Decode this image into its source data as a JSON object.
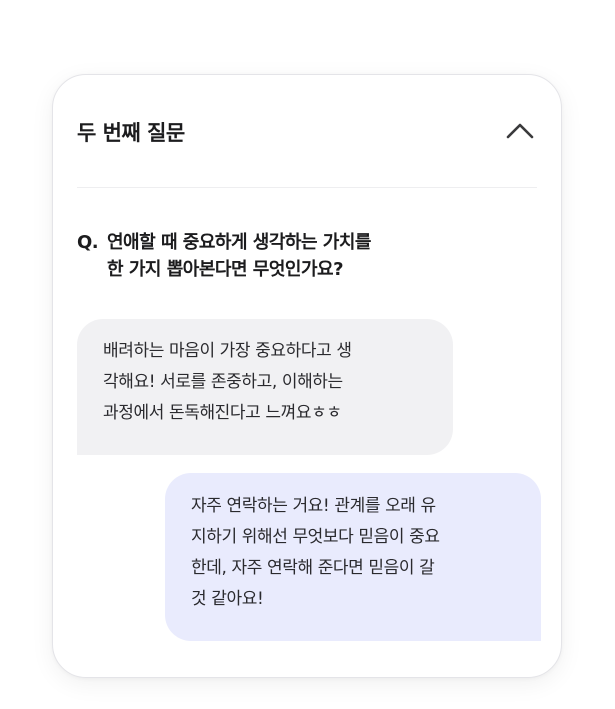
{
  "card": {
    "title": "두 번째 질문",
    "toggle_icon": "chevron-up-icon"
  },
  "question": {
    "prefix": "Q.",
    "line1": "연애할 때 중요하게 생각하는 가치를",
    "line2": "한 가지 뽑아본다면 무엇인가요?"
  },
  "answers": [
    {
      "side": "left",
      "lines": [
        "배려하는 마음이 가장 중요하다고 생",
        "각해요! 서로를 존중하고, 이해하는",
        "과정에서 돈독해진다고 느껴요ㅎㅎ"
      ]
    },
    {
      "side": "right",
      "lines": [
        "자주 연락하는 거요! 관계를 오래 유",
        "지하기 위해선 무엇보다 믿음이 중요",
        "한데, 자주 연락해 준다면 믿음이 갈",
        "것 같아요!"
      ]
    }
  ],
  "colors": {
    "left_bubble": "#f1f1f3",
    "right_bubble": "#e9ebfd",
    "text": "#1c1c1e"
  }
}
